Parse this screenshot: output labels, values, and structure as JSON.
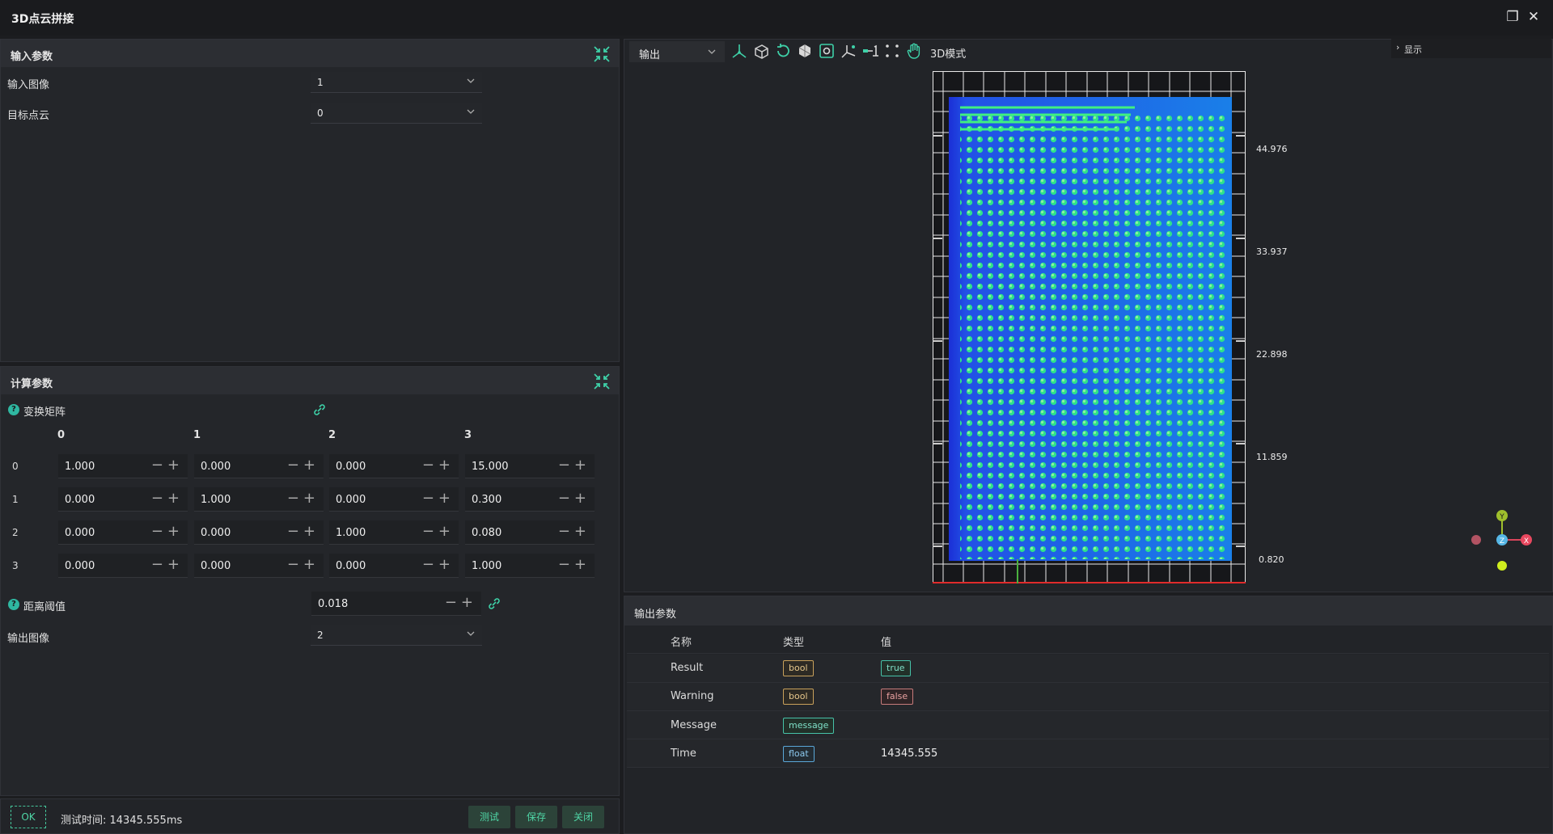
{
  "window": {
    "title": "3D点云拼接"
  },
  "input_params": {
    "header": "输入参数",
    "rows": [
      {
        "label": "输入图像",
        "value": "1"
      },
      {
        "label": "目标点云",
        "value": "0"
      }
    ]
  },
  "calc_params": {
    "header": "计算参数",
    "matrix_label": "变换矩阵",
    "col_headers": [
      "0",
      "1",
      "2",
      "3"
    ],
    "row_headers": [
      "0",
      "1",
      "2",
      "3"
    ],
    "matrix": [
      [
        "1.000",
        "0.000",
        "0.000",
        "15.000"
      ],
      [
        "0.000",
        "1.000",
        "0.000",
        "0.300"
      ],
      [
        "0.000",
        "0.000",
        "1.000",
        "0.080"
      ],
      [
        "0.000",
        "0.000",
        "0.000",
        "1.000"
      ]
    ],
    "distance_label": "距离阈值",
    "distance_value": "0.018",
    "output_image_label": "输出图像",
    "output_image_value": "2",
    "stepper_minus": "−",
    "stepper_plus": "+"
  },
  "footer": {
    "ok": "OK",
    "test_time": "测试时间: 14345.555ms",
    "test_btn": "测试",
    "save_btn": "保存",
    "close_btn": "关闭"
  },
  "viewer": {
    "output_select": "输出",
    "mode_label": "3D模式",
    "display_toggle": "显示",
    "y_ticks": [
      "44.976",
      "33.937",
      "22.898",
      "11.859",
      "0.820"
    ],
    "axes": {
      "y": "Y",
      "z": "Z",
      "x": "X"
    }
  },
  "output_params": {
    "header": "输出参数",
    "columns": [
      "名称",
      "类型",
      "值"
    ],
    "rows": [
      {
        "name": "Result",
        "type": "bool",
        "value": "true"
      },
      {
        "name": "Warning",
        "type": "bool",
        "value": "false"
      },
      {
        "name": "Message",
        "type": "message",
        "value": ""
      },
      {
        "name": "Time",
        "type": "float",
        "value": "14345.555"
      }
    ]
  },
  "colors": {
    "accent": "#4fd6a6",
    "background": "#1c1d20",
    "panel": "#24262a"
  }
}
